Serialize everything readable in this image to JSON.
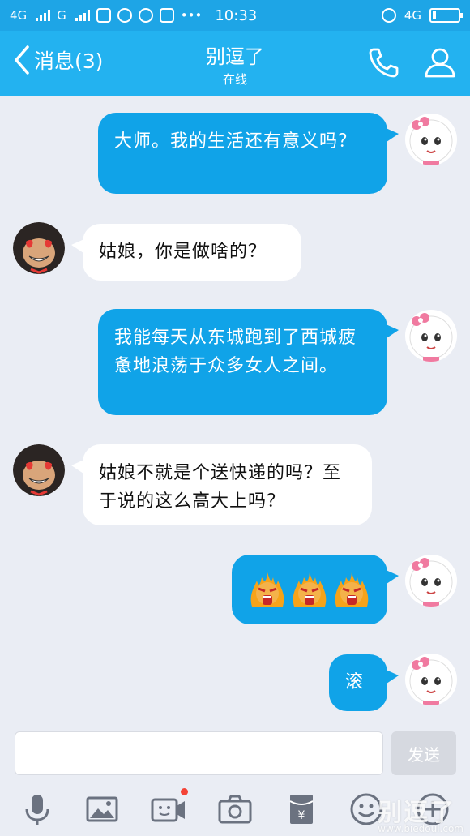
{
  "status_bar": {
    "network1": "4G",
    "network2": "G",
    "time": "10:33",
    "network_right": "4G"
  },
  "header": {
    "back_label": "消息(3)",
    "title": "别逗了",
    "subtitle": "在线"
  },
  "messages": [
    {
      "side": "out",
      "text": "大师。我的生活还有意义吗？"
    },
    {
      "side": "in",
      "text": "姑娘，你是做啥的？"
    },
    {
      "side": "out",
      "text": "我能每天从东城跑到了西城疲惫地浪荡于众多女人之间。"
    },
    {
      "side": "in",
      "text": "姑娘不就是个送快递的吗？至于说的这么高大上吗？"
    },
    {
      "side": "out",
      "type": "emoji",
      "emoji_icons": [
        "angry-fire-emoji",
        "angry-fire-emoji",
        "angry-fire-emoji"
      ]
    },
    {
      "side": "out",
      "text": "滚"
    }
  ],
  "input": {
    "placeholder": "",
    "value": "",
    "send_label": "发送"
  },
  "toolbar": {
    "icons": [
      "microphone-icon",
      "image-icon",
      "video-call-icon",
      "camera-icon",
      "red-packet-icon",
      "smiley-icon",
      "plus-icon"
    ],
    "video_has_notification": true
  },
  "watermark": {
    "text": "别逗了",
    "url": "www.biedoul.com"
  },
  "colors": {
    "header": "#23b2f0",
    "status_bar": "#1ea5e6",
    "outgoing_bubble": "#10a3e8",
    "incoming_bubble": "#ffffff",
    "background": "#eaedf4"
  }
}
